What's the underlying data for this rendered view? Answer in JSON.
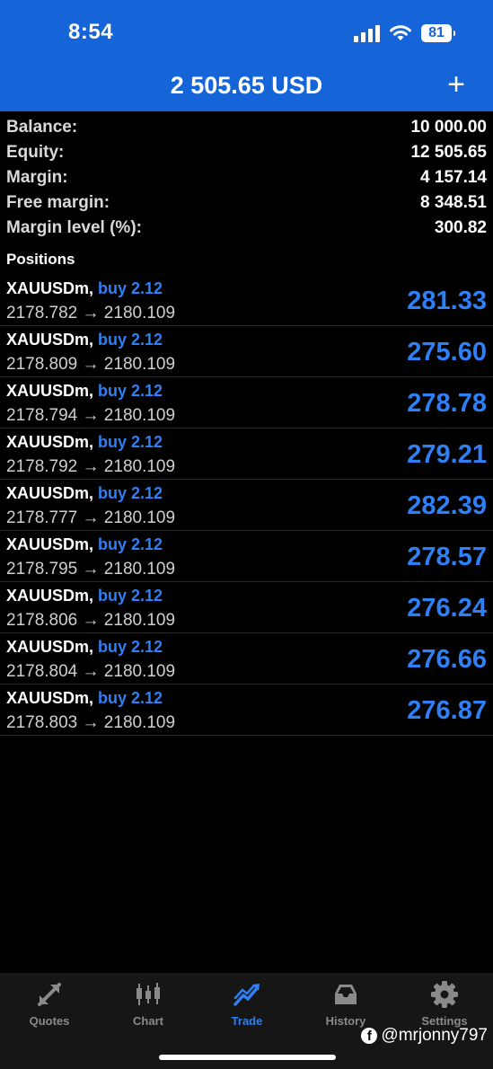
{
  "status_bar": {
    "time": "8:54",
    "battery": "81"
  },
  "header": {
    "title": "2 505.65 USD",
    "add_label": "+"
  },
  "summary": [
    {
      "label": "Balance:",
      "value": "10 000.00"
    },
    {
      "label": "Equity:",
      "value": "12 505.65"
    },
    {
      "label": "Margin:",
      "value": "4 157.14"
    },
    {
      "label": "Free margin:",
      "value": "8 348.51"
    },
    {
      "label": "Margin level (%):",
      "value": "300.82"
    }
  ],
  "positions_title": "Positions",
  "positions": [
    {
      "symbol": "XAUUSDm,",
      "direction": "buy 2.12",
      "prices": "2178.782 → 2180.109",
      "profit": "281.33"
    },
    {
      "symbol": "XAUUSDm,",
      "direction": "buy 2.12",
      "prices": "2178.809 → 2180.109",
      "profit": "275.60"
    },
    {
      "symbol": "XAUUSDm,",
      "direction": "buy 2.12",
      "prices": "2178.794 → 2180.109",
      "profit": "278.78"
    },
    {
      "symbol": "XAUUSDm,",
      "direction": "buy 2.12",
      "prices": "2178.792 → 2180.109",
      "profit": "279.21"
    },
    {
      "symbol": "XAUUSDm,",
      "direction": "buy 2.12",
      "prices": "2178.777 → 2180.109",
      "profit": "282.39"
    },
    {
      "symbol": "XAUUSDm,",
      "direction": "buy 2.12",
      "prices": "2178.795 → 2180.109",
      "profit": "278.57"
    },
    {
      "symbol": "XAUUSDm,",
      "direction": "buy 2.12",
      "prices": "2178.806 → 2180.109",
      "profit": "276.24"
    },
    {
      "symbol": "XAUUSDm,",
      "direction": "buy 2.12",
      "prices": "2178.804 → 2180.109",
      "profit": "276.66"
    },
    {
      "symbol": "XAUUSDm,",
      "direction": "buy 2.12",
      "prices": "2178.803 → 2180.109",
      "profit": "276.87"
    }
  ],
  "tabs": [
    {
      "label": "Quotes",
      "icon": "quotes-arrows-icon",
      "active": false
    },
    {
      "label": "Chart",
      "icon": "candlestick-chart-icon",
      "active": false
    },
    {
      "label": "Trade",
      "icon": "trade-trend-icon",
      "active": true
    },
    {
      "label": "History",
      "icon": "history-inbox-icon",
      "active": false
    },
    {
      "label": "Settings",
      "icon": "gear-icon",
      "active": false
    }
  ],
  "watermark": {
    "logo": "f",
    "text": "@mrjonny797"
  },
  "colors": {
    "header_bg": "#1565d8",
    "accent_blue": "#2f7ff5",
    "tab_inactive": "#8a8a8a"
  }
}
